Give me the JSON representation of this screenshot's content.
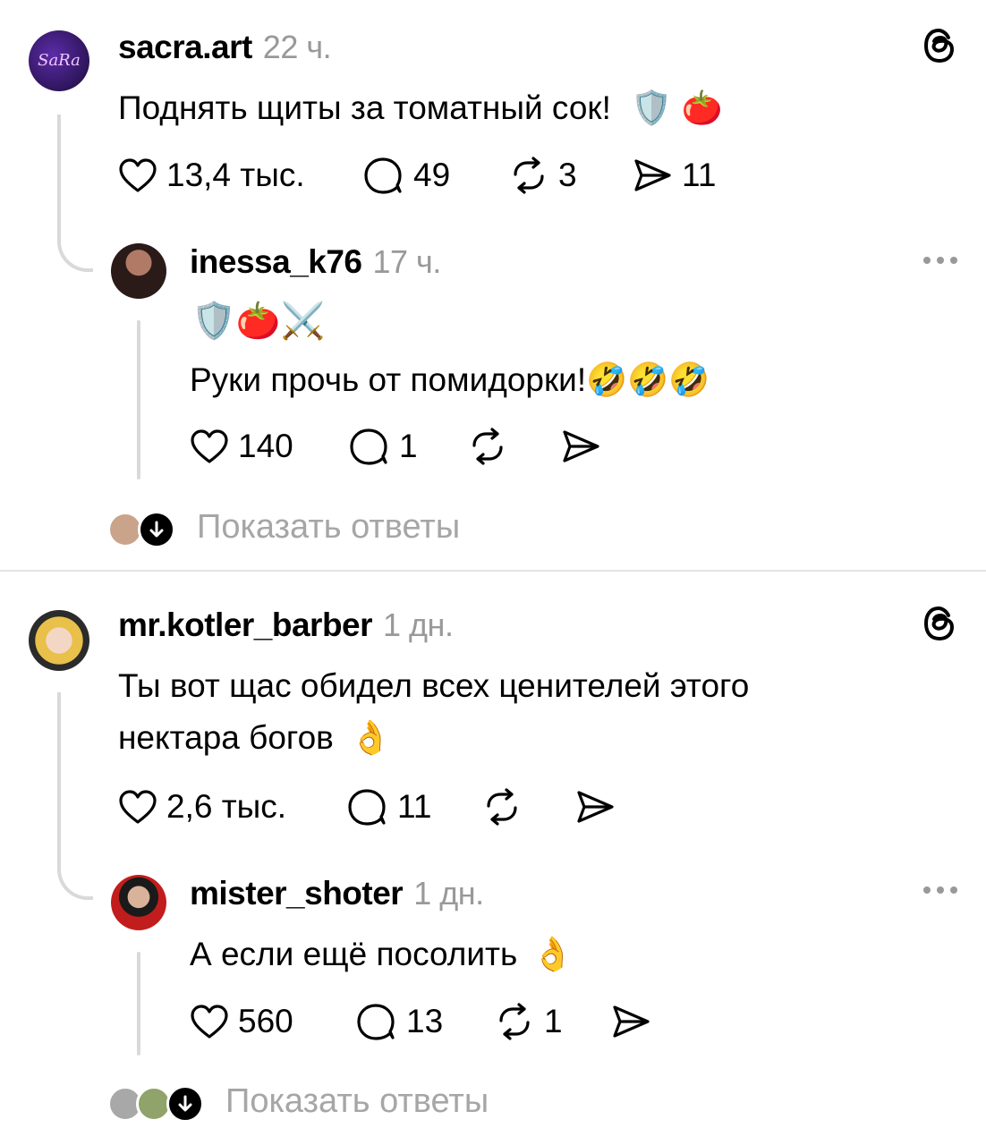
{
  "posts": [
    {
      "username": "sacra.art",
      "time": "22 ч.",
      "text": "Поднять щиты за томатный сок!",
      "emoji": "🛡️ 🍅",
      "avatar_text": "SaRa",
      "likes": "13,4 тыс.",
      "comments": "49",
      "reposts": "3",
      "shares": "11",
      "reply": {
        "username": "inessa_k76",
        "time": "17 ч.",
        "emoji_line": "🛡️🍅⚔️",
        "text": "Руки прочь от помидорки!",
        "text_emoji": "🤣🤣🤣",
        "likes": "140",
        "comments": "1"
      },
      "show_replies": "Показать ответы"
    },
    {
      "username": "mr.kotler_barber",
      "time": "1 дн.",
      "text_line1": "Ты вот щас обидел всех ценителей этого",
      "text_line2": "нектара богов",
      "emoji": "👌",
      "likes": "2,6 тыс.",
      "comments": "11",
      "reply": {
        "username": "mister_shoter",
        "time": "1 дн.",
        "text": "А если ещё посолить",
        "text_emoji": "👌",
        "likes": "560",
        "comments": "13",
        "reposts": "1"
      },
      "show_replies": "Показать ответы"
    }
  ],
  "icons": {
    "threads": "threads-logo-icon",
    "like": "heart-icon",
    "comment": "comment-bubble-icon",
    "repost": "repost-icon",
    "share": "send-icon",
    "more": "more-dots-icon",
    "expand": "arrow-down-icon"
  }
}
